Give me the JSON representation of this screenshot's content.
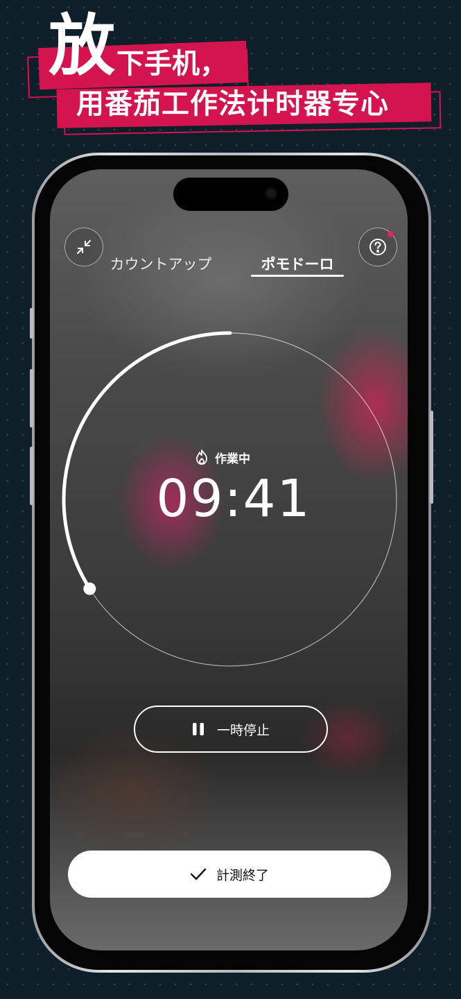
{
  "promo": {
    "big_char": "放",
    "line1": "下手机，",
    "line2": "用番茄工作法计时器专心",
    "accent_color": "#d4144f"
  },
  "header": {
    "collapse_icon": "collapse-arrows-icon",
    "help_icon": "question-circle-icon",
    "help_badge_color": "#e0245e"
  },
  "tabs": [
    {
      "label": "カウントアップ",
      "active": false
    },
    {
      "label": "ポモドーロ",
      "active": true
    }
  ],
  "timer": {
    "status_icon": "flame-icon",
    "status_label": "作業中",
    "time": "09:41",
    "progress_fraction": 0.34
  },
  "controls": {
    "pause_icon": "pause-icon",
    "pause_label": "一時停止",
    "finish_icon": "checkmark-icon",
    "finish_label": "計測終了"
  }
}
